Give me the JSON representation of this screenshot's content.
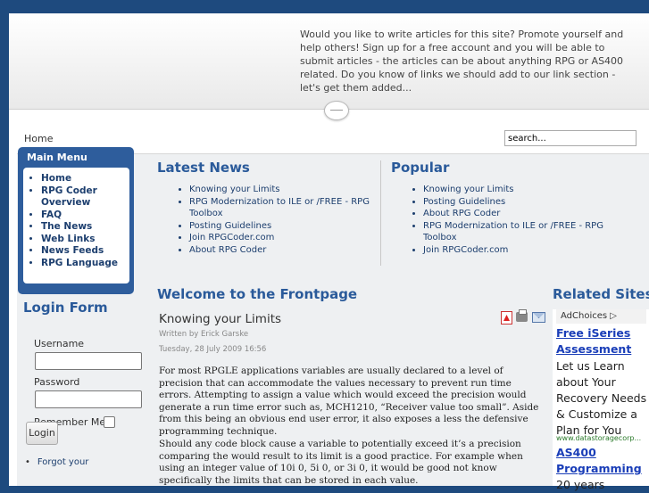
{
  "header": {
    "promo_text": "Would you like to write articles for this site?  Promote yourself and help others!  Sign up for a free account and you will be able to submit articles - the articles can be about anything RPG or AS400 related.  Do you know of links we should add to our link section - let's get them added..."
  },
  "nav": {
    "breadcrumb": "Home",
    "search_value": "search..."
  },
  "main_menu": {
    "title": "Main Menu",
    "items": [
      "Home",
      "RPG Coder Overview",
      "FAQ",
      "The News",
      "Web Links",
      "News Feeds",
      "RPG Language"
    ]
  },
  "login": {
    "title": "Login Form",
    "username_label": "Username",
    "password_label": "Password",
    "remember_label": "Remember Me",
    "login_button": "Login",
    "forgot_link": "Forgot your"
  },
  "latest_news": {
    "title": "Latest News",
    "items": [
      "Knowing your Limits",
      "RPG Modernization to ILE or /FREE - RPG Toolbox",
      "Posting Guidelines",
      "Join RPGCoder.com",
      "About RPG Coder"
    ]
  },
  "popular": {
    "title": "Popular",
    "items": [
      "Knowing your Limits",
      "Posting Guidelines",
      "About RPG Coder",
      "RPG Modernization to ILE or /FREE - RPG Toolbox",
      "Join RPGCoder.com"
    ]
  },
  "frontpage": {
    "title": "Welcome to the Frontpage",
    "article": {
      "title": "Knowing your Limits",
      "author": "Written by Erick Garske",
      "date": "Tuesday, 28 July 2009 16:56",
      "paragraph1": "For most RPGLE applications variables are usually declared to a level of precision that can accommodate the values necessary to prevent run time errors. Attempting to assign a value which would exceed the precision would generate a run time error such as, MCH1210, “Receiver value too small”. Aside from this being an obvious end user error, it also exposes a less the defensive programming technique.",
      "paragraph2": "Should any code block cause a variable to potentially exceed it’s a precision comparing the would result to its limit is a good practice. For example when using an integer value of 10i 0, 5i 0, or 3i 0, it would be good not know specifically the limits that can be stored in each value."
    }
  },
  "related": {
    "title": "Related Sites"
  },
  "ad": {
    "adchoices": "AdChoices ▷",
    "headline1": "Free iSeries",
    "headline1b": "Assessment",
    "body": "Let us Learn about Your Recovery Needs & Customize a Plan for You",
    "url": "www.datastoragecorp...",
    "headline2": "AS400",
    "headline2b": "Programming",
    "body2": "20 years"
  },
  "icons": [
    "pdf-icon",
    "print-icon",
    "email-icon"
  ]
}
